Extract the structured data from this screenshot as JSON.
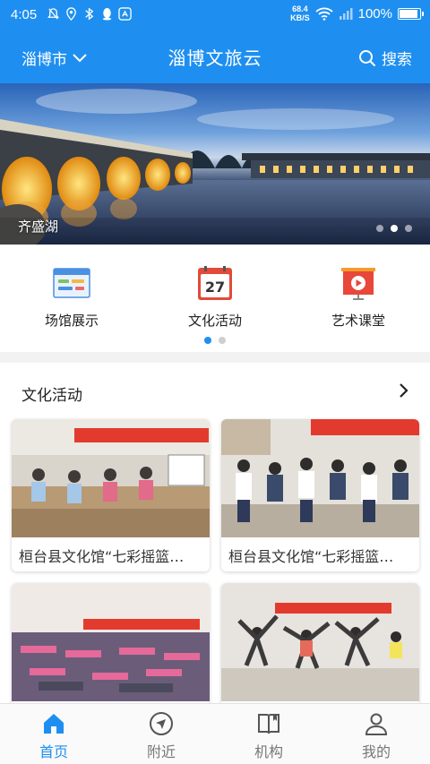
{
  "status_bar": {
    "time": "4:05",
    "net_speed_value": "68.4",
    "net_speed_unit": "KB/S",
    "battery": "100%",
    "icons": [
      "notification-off-icon",
      "location-icon",
      "bluetooth-icon",
      "qq-icon",
      "app-store-icon",
      "wifi-icon",
      "signal-icon",
      "battery-icon"
    ]
  },
  "header": {
    "city": "淄博市",
    "title": "淄博文旅云",
    "search_label": "搜索"
  },
  "banner": {
    "caption": "齐盛湖",
    "slide_count": 3,
    "active_slide": 2
  },
  "categories": {
    "items": [
      {
        "label": "场馆展示",
        "icon": "venue-display-icon"
      },
      {
        "label": "文化活动",
        "icon": "calendar-icon",
        "icon_text": "27"
      },
      {
        "label": "艺术课堂",
        "icon": "video-class-icon"
      }
    ],
    "pages": 2,
    "active_page": 1
  },
  "activities": {
    "title": "文化活动",
    "cards": [
      {
        "caption": "桓台县文化馆“七彩摇篮…"
      },
      {
        "caption": "桓台县文化馆“七彩摇篮…"
      },
      {
        "caption": ""
      },
      {
        "caption": ""
      }
    ]
  },
  "bottom_nav": {
    "items": [
      {
        "label": "首页",
        "icon": "home-icon",
        "active": true
      },
      {
        "label": "附近",
        "icon": "navigation-arrow-icon",
        "active": false
      },
      {
        "label": "机构",
        "icon": "book-icon",
        "active": false
      },
      {
        "label": "我的",
        "icon": "user-icon",
        "active": false
      }
    ]
  },
  "colors": {
    "brand_blue": "#1e8ff0",
    "inactive_gray": "#777777"
  }
}
